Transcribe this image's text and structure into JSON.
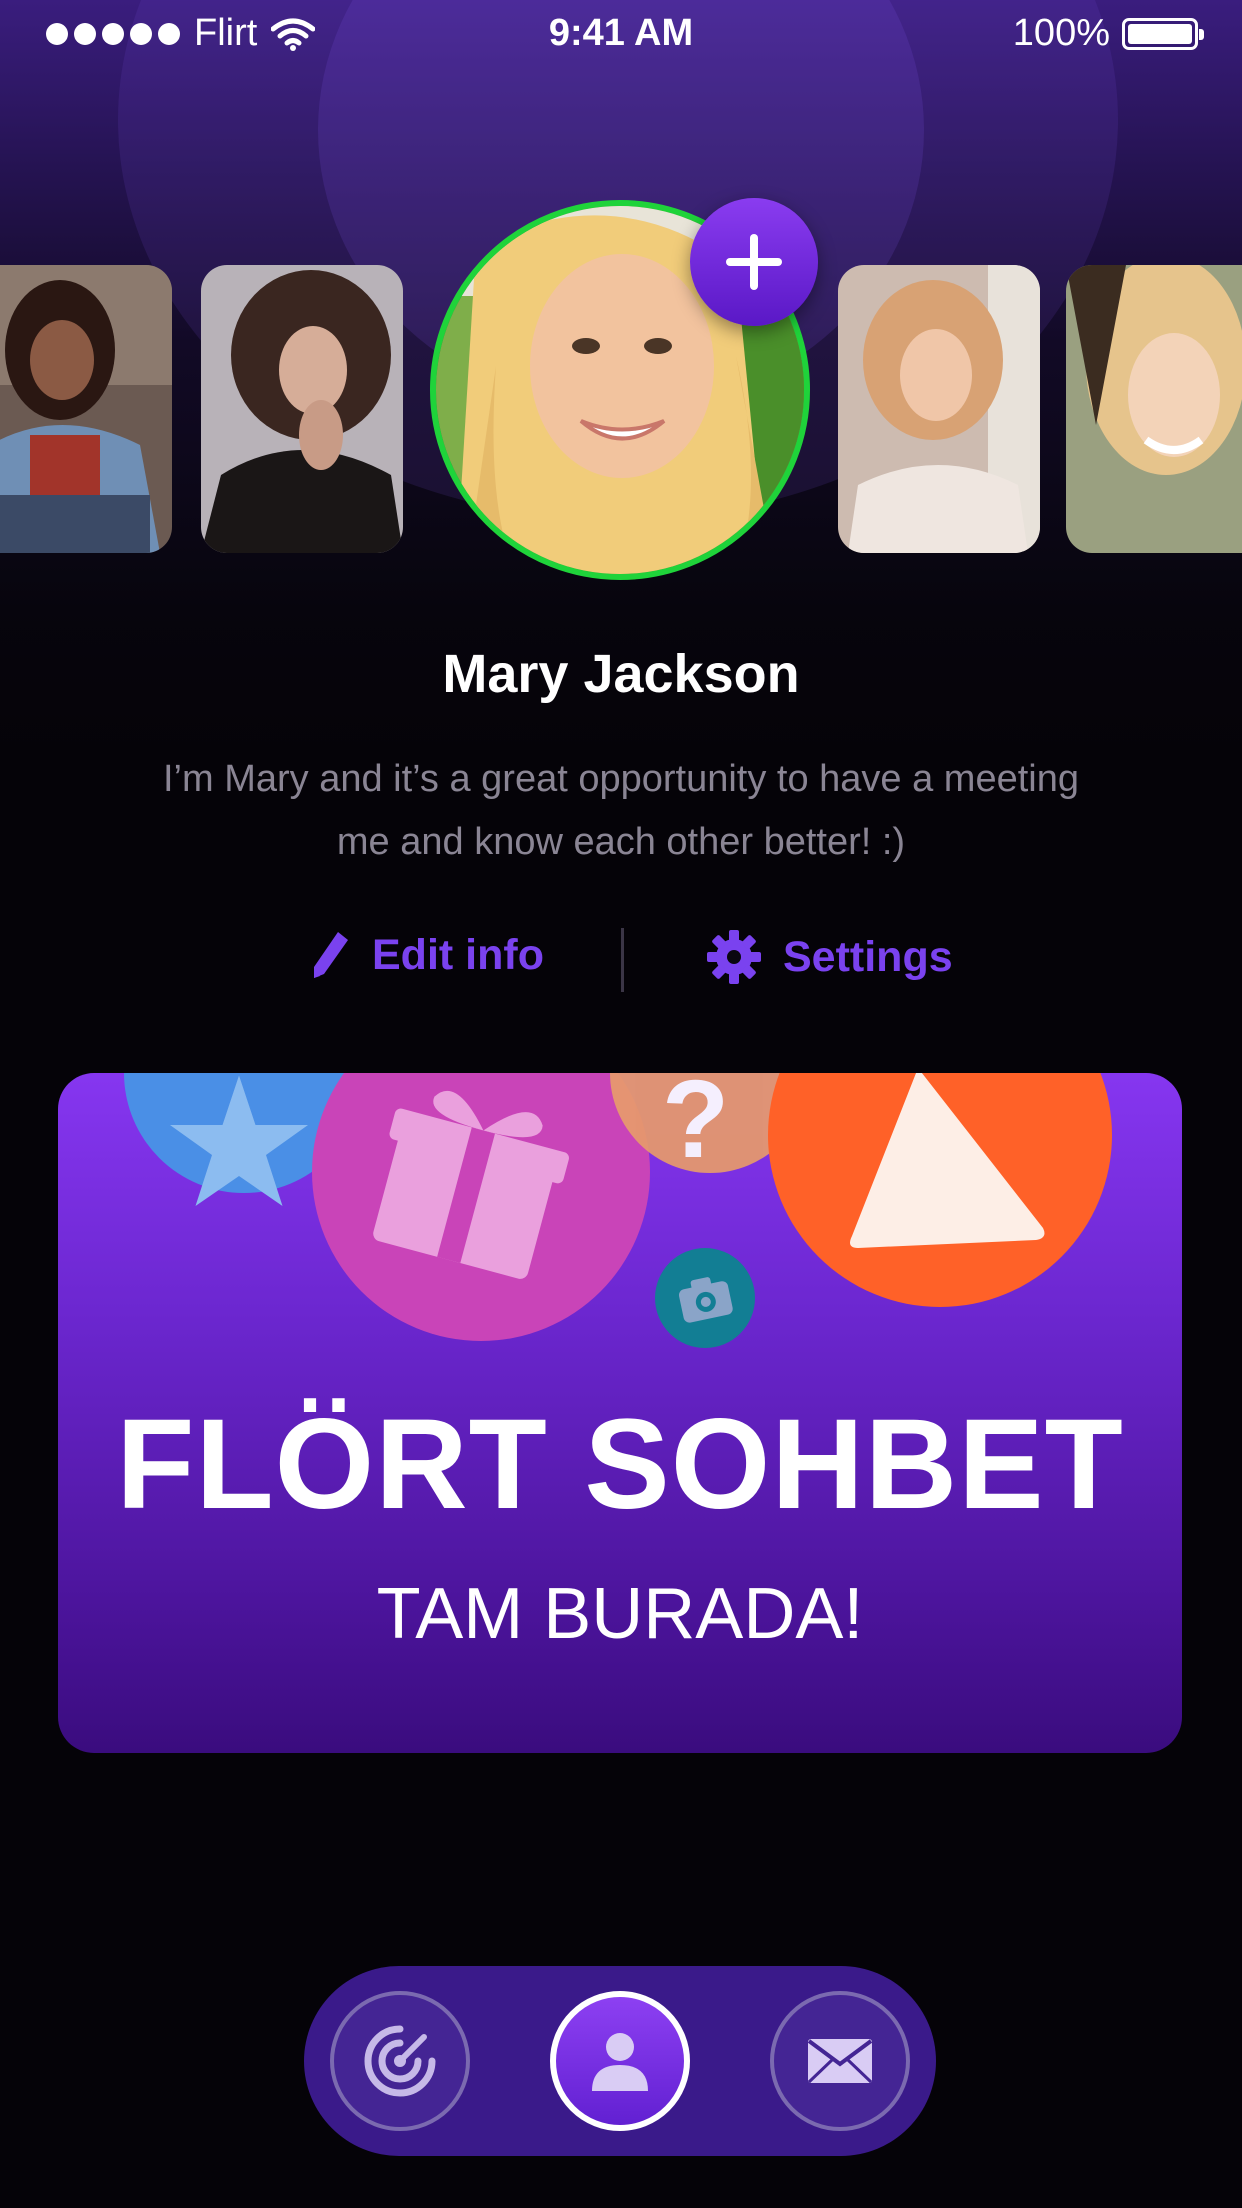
{
  "status_bar": {
    "carrier": "Flirt",
    "time": "9:41 AM",
    "battery": "100%"
  },
  "profile": {
    "name": "Mary Jackson",
    "bio": "I’m Mary and it’s a great opportunity to have a meeting me and know each other better! :)",
    "edit_label": "Edit info",
    "settings_label": "Settings"
  },
  "promo": {
    "title": "FLÖRT SOHBET",
    "subtitle": "TAM BURADA!"
  },
  "tabbar": {
    "items": [
      "radar-icon",
      "profile-icon",
      "mail-icon"
    ],
    "active_index": 1
  },
  "colors": {
    "accent": "#7a42ef",
    "online_ring": "#1fd33a",
    "tabbar_bg": "#3a1a8a"
  }
}
